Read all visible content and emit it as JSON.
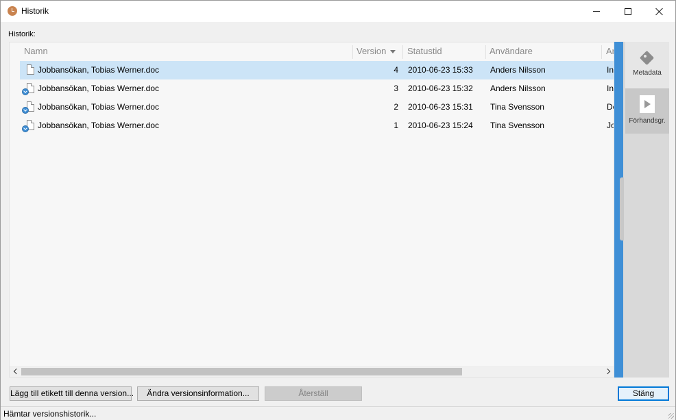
{
  "window": {
    "title": "Historik",
    "controls": {
      "minimize": "minimize-icon",
      "maximize": "maximize-icon",
      "close": "close-icon"
    }
  },
  "section_label": "Historik:",
  "table": {
    "columns": [
      "Namn",
      "Version",
      "Statustid",
      "Användare",
      "An"
    ],
    "sort_column": "Version",
    "sort_direction": "descending",
    "rows": [
      {
        "name": "Jobbansökan, Tobias Werner.doc",
        "version": "4",
        "statustid": "2010-06-23 15:33",
        "user": "Anders Nilsson",
        "extra": "Int",
        "selected": true
      },
      {
        "name": "Jobbansökan, Tobias Werner.doc",
        "version": "3",
        "statustid": "2010-06-23 15:32",
        "user": "Anders Nilsson",
        "extra": "Int",
        "selected": false
      },
      {
        "name": "Jobbansökan, Tobias Werner.doc",
        "version": "2",
        "statustid": "2010-06-23 15:31",
        "user": "Tina Svensson",
        "extra": "De",
        "selected": false
      },
      {
        "name": "Jobbansökan, Tobias Werner.doc",
        "version": "1",
        "statustid": "2010-06-23 15:24",
        "user": "Tina Svensson",
        "extra": "Jo",
        "selected": false
      }
    ]
  },
  "side_panel": {
    "tabs": [
      {
        "label": "Metadata",
        "icon": "tag-icon"
      },
      {
        "label": "Förhandsgr.",
        "icon": "play-icon"
      }
    ],
    "accent_color": "#3f8fd6"
  },
  "buttons": {
    "add_label": "Lägg till etikett till denna version...",
    "edit_info": "Ändra versionsinformation...",
    "restore": "Återställ",
    "close": "Stäng"
  },
  "status": "Hämtar versionshistorik...",
  "colors": {
    "selection": "#cce4f7",
    "primary_border": "#0078d7"
  }
}
